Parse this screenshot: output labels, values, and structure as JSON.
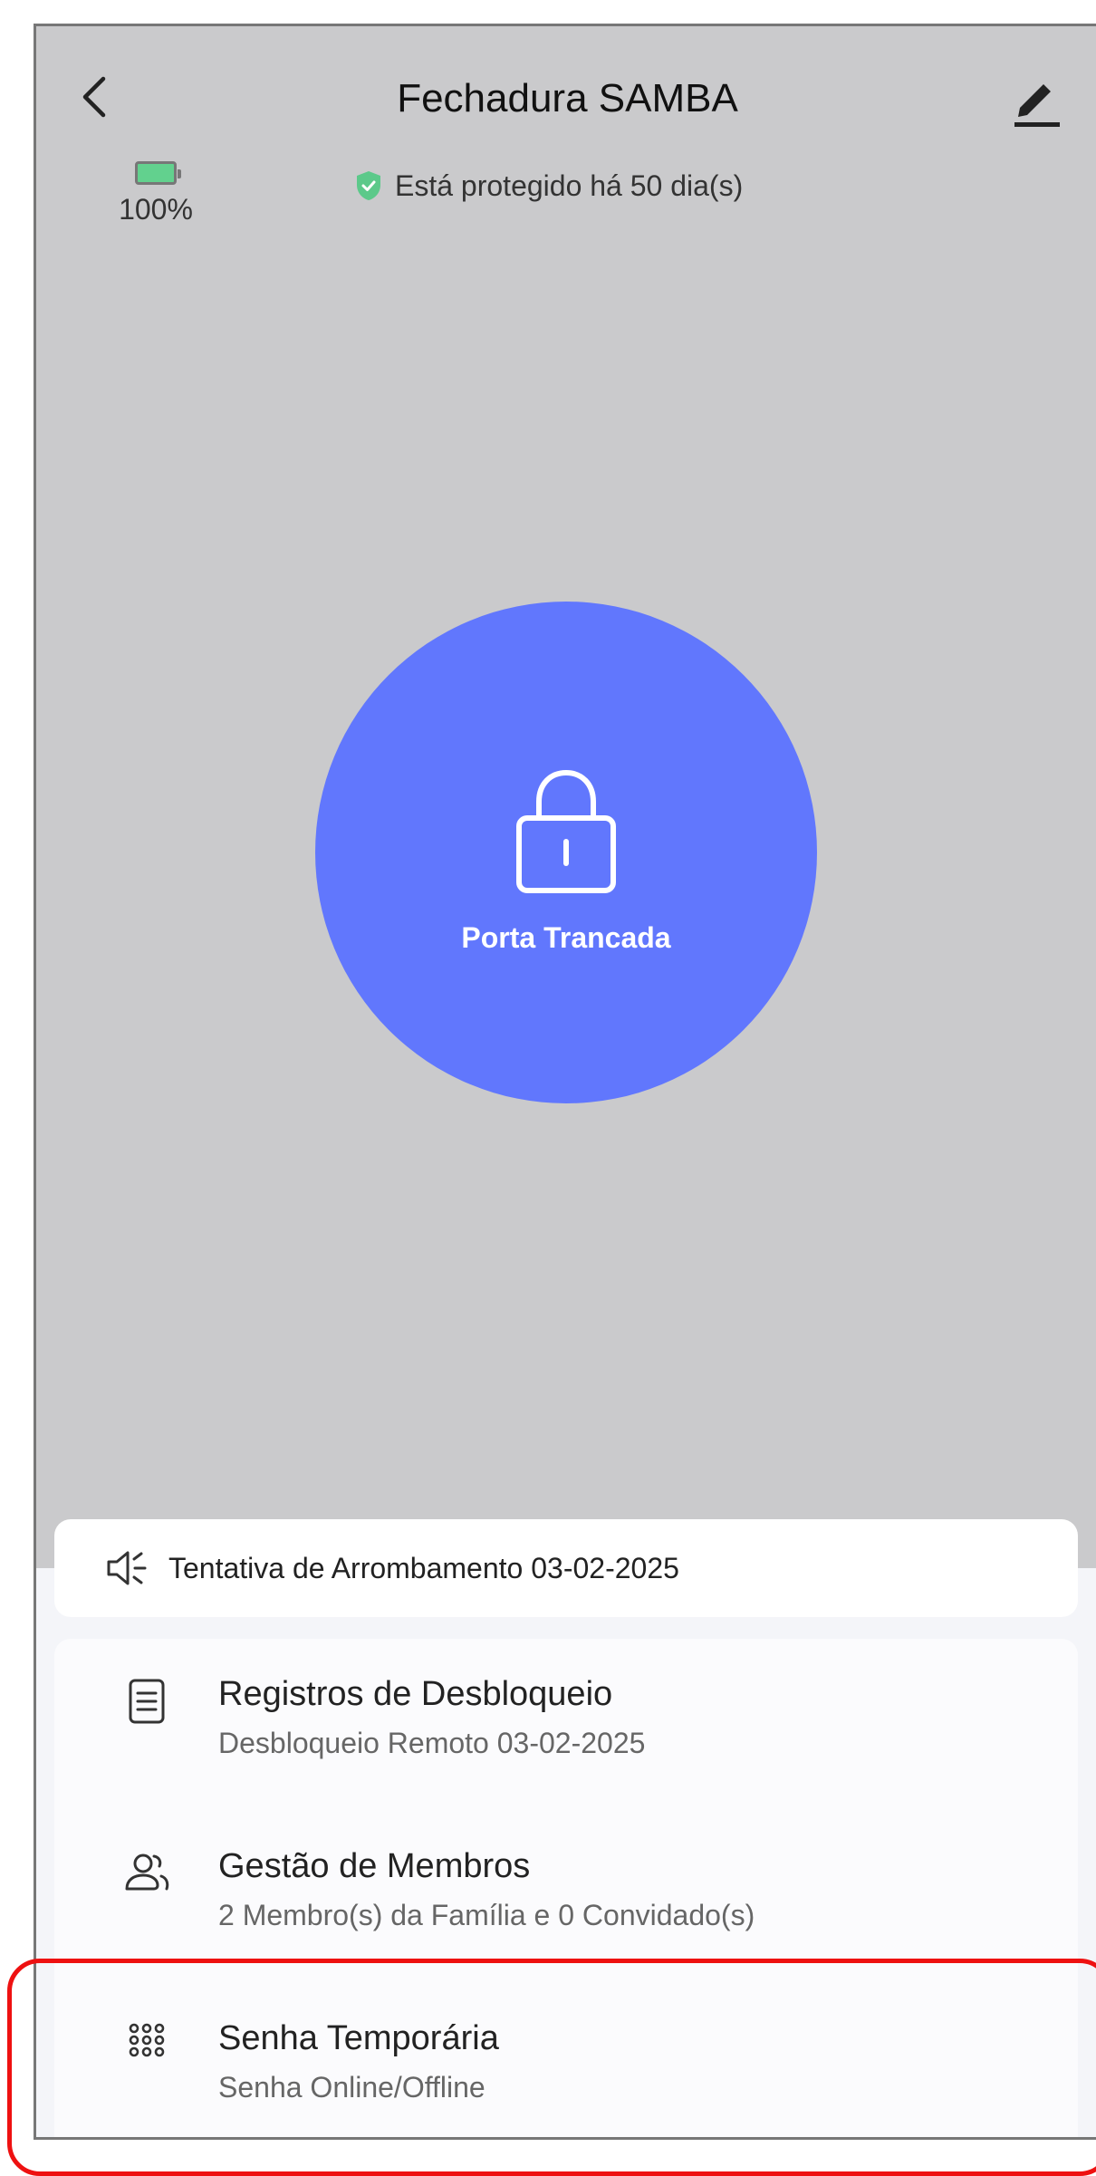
{
  "header": {
    "title": "Fechadura SAMBA"
  },
  "status": {
    "battery_label": "100%",
    "battery_level_percent": 100,
    "protection_text": "Está protegido há 50 dia(s)"
  },
  "lock": {
    "state_label": "Porta Trancada"
  },
  "alarm": {
    "text": "Tentativa de Arrombamento 03-02-2025"
  },
  "menu": {
    "items": [
      {
        "label": "Registros de Desbloqueio",
        "subtitle": "Desbloqueio Remoto 03-02-2025",
        "icon": "document-icon"
      },
      {
        "label": "Gestão de Membros",
        "subtitle": "2 Membro(s) da Família e 0 Convidado(s)",
        "icon": "members-icon"
      },
      {
        "label": "Senha Temporária",
        "subtitle": "Senha Online/Offline",
        "icon": "keypad-icon"
      }
    ]
  },
  "colors": {
    "background_top": "#cacacc",
    "lock_circle": "#6177fd",
    "battery_fill": "#62d18e",
    "shield": "#5cc98a",
    "highlight": "#ee1111"
  }
}
